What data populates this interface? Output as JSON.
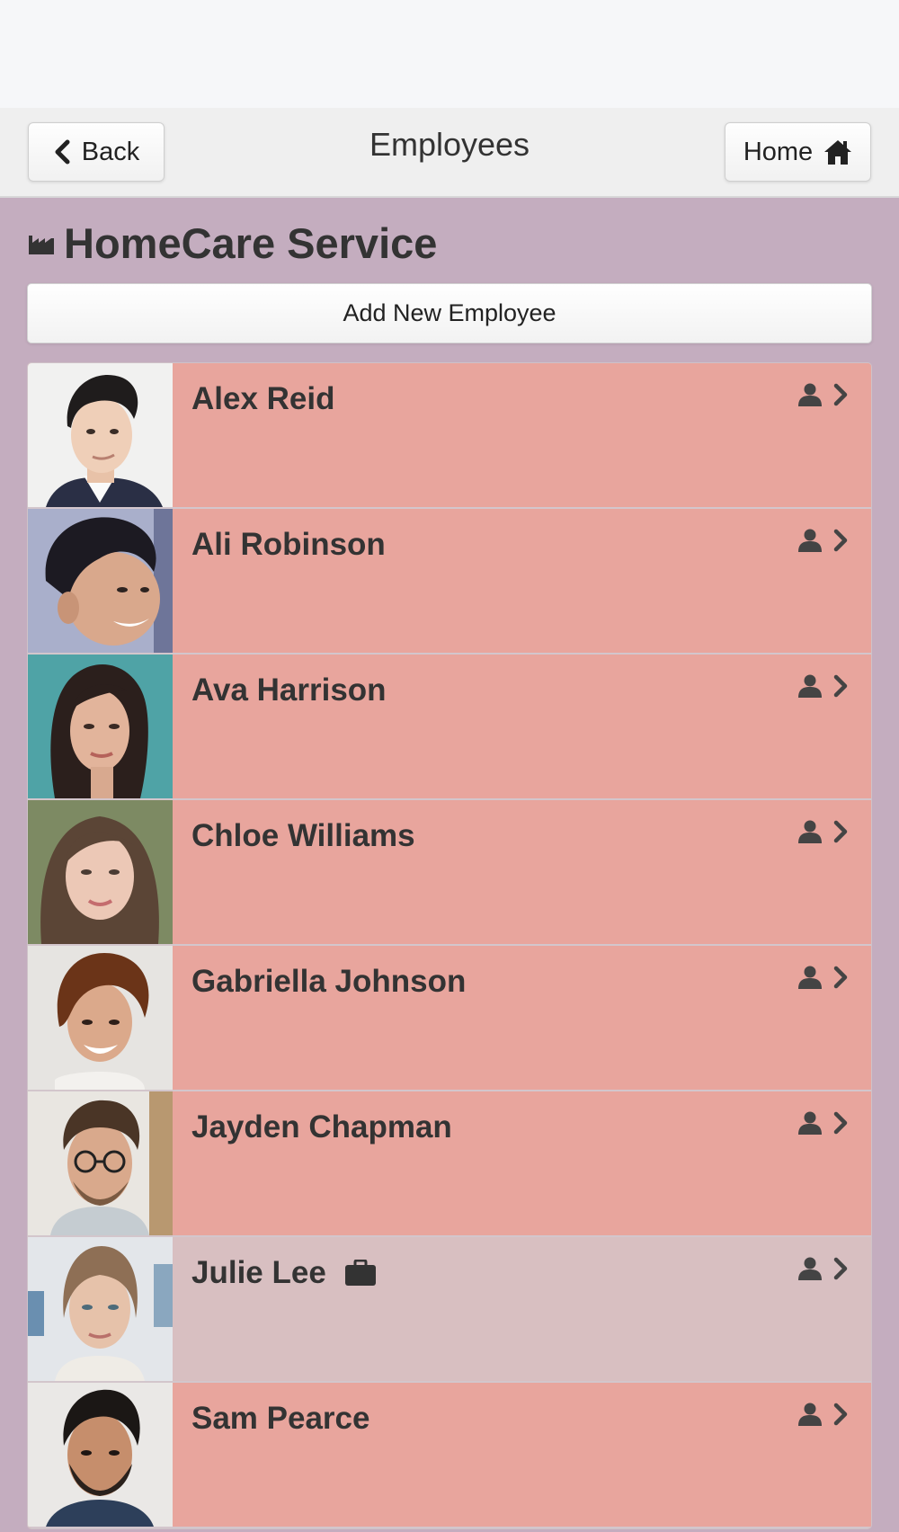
{
  "header": {
    "back_label": "Back",
    "title": "Employees",
    "home_label": "Home"
  },
  "page": {
    "heading": "HomeCare Service",
    "heading_icon": "factory-icon",
    "add_button_label": "Add New Employee"
  },
  "employees": [
    {
      "name": "Alex Reid",
      "badge": null
    },
    {
      "name": "Ali Robinson",
      "badge": null
    },
    {
      "name": "Ava Harrison",
      "badge": null
    },
    {
      "name": "Chloe Williams",
      "badge": null
    },
    {
      "name": "Gabriella Johnson",
      "badge": null
    },
    {
      "name": "Jayden Chapman",
      "badge": null
    },
    {
      "name": "Julie Lee",
      "badge": "briefcase-icon"
    },
    {
      "name": "Sam Pearce",
      "badge": null
    }
  ],
  "colors": {
    "page_background": "#c4adbf",
    "row_background": "#e8a59d",
    "row_highlight_background": "#d8bfc1",
    "navbar_background": "#efefef"
  }
}
